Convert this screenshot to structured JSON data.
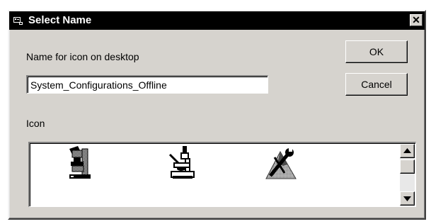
{
  "window": {
    "title": "Select Name",
    "close_glyph": "✕"
  },
  "form": {
    "name_label": "Name for icon on desktop",
    "name_value": "System_Configurations_Offline",
    "icon_label": "Icon"
  },
  "buttons": {
    "ok": "OK",
    "cancel": "Cancel"
  },
  "icon_list": {
    "items": [
      "microscope-icon",
      "inverted-microscope-icon",
      "tools-mountain-icon"
    ],
    "scroll_up_glyph": "▲",
    "scroll_down_glyph": "▼"
  },
  "colors": {
    "titlebar": "#000000",
    "dialog_face": "#d6d3ce"
  }
}
